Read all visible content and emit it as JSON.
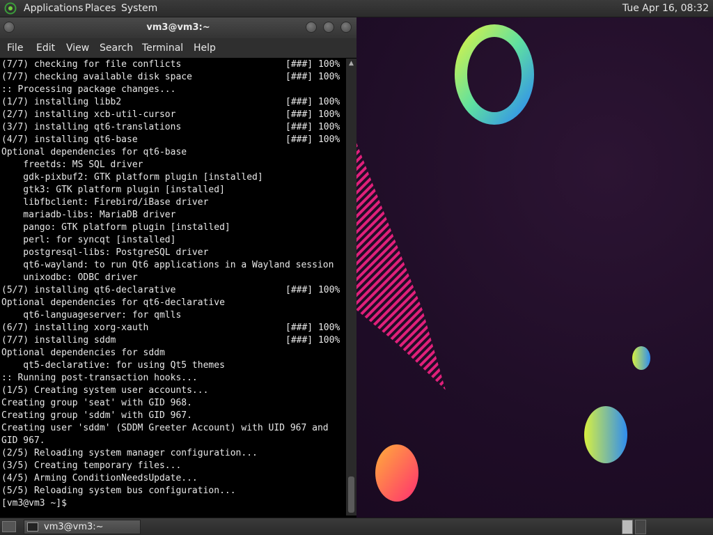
{
  "top_panel": {
    "menus": [
      "Applications",
      "Places",
      "System"
    ],
    "clock": "Tue Apr 16, 08:32"
  },
  "terminal": {
    "title": "vm3@vm3:~",
    "menu": [
      "File",
      "Edit",
      "View",
      "Search",
      "Terminal",
      "Help"
    ],
    "lines": [
      {
        "text": "(7/7) checking for file conflicts",
        "status": "[###] 100%"
      },
      {
        "text": "(7/7) checking available disk space",
        "status": "[###] 100%"
      },
      {
        "text": ":: Processing package changes...",
        "status": ""
      },
      {
        "text": "(1/7) installing libb2",
        "status": "[###] 100%"
      },
      {
        "text": "(2/7) installing xcb-util-cursor",
        "status": "[###] 100%"
      },
      {
        "text": "(3/7) installing qt6-translations",
        "status": "[###] 100%"
      },
      {
        "text": "(4/7) installing qt6-base",
        "status": "[###] 100%"
      },
      {
        "text": "Optional dependencies for qt6-base",
        "status": ""
      },
      {
        "text": "    freetds: MS SQL driver",
        "status": ""
      },
      {
        "text": "    gdk-pixbuf2: GTK platform plugin [installed]",
        "status": ""
      },
      {
        "text": "    gtk3: GTK platform plugin [installed]",
        "status": ""
      },
      {
        "text": "    libfbclient: Firebird/iBase driver",
        "status": ""
      },
      {
        "text": "    mariadb-libs: MariaDB driver",
        "status": ""
      },
      {
        "text": "    pango: GTK platform plugin [installed]",
        "status": ""
      },
      {
        "text": "    perl: for syncqt [installed]",
        "status": ""
      },
      {
        "text": "    postgresql-libs: PostgreSQL driver",
        "status": ""
      },
      {
        "text": "    qt6-wayland: to run Qt6 applications in a Wayland session",
        "status": ""
      },
      {
        "text": "    unixodbc: ODBC driver",
        "status": ""
      },
      {
        "text": "(5/7) installing qt6-declarative",
        "status": "[###] 100%"
      },
      {
        "text": "Optional dependencies for qt6-declarative",
        "status": ""
      },
      {
        "text": "    qt6-languageserver: for qmlls",
        "status": ""
      },
      {
        "text": "(6/7) installing xorg-xauth",
        "status": "[###] 100%"
      },
      {
        "text": "(7/7) installing sddm",
        "status": "[###] 100%"
      },
      {
        "text": "Optional dependencies for sddm",
        "status": ""
      },
      {
        "text": "    qt5-declarative: for using Qt5 themes",
        "status": ""
      },
      {
        "text": ":: Running post-transaction hooks...",
        "status": ""
      },
      {
        "text": "(1/5) Creating system user accounts...",
        "status": ""
      },
      {
        "text": "Creating group 'seat' with GID 968.",
        "status": ""
      },
      {
        "text": "Creating group 'sddm' with GID 967.",
        "status": ""
      },
      {
        "text": "Creating user 'sddm' (SDDM Greeter Account) with UID 967 and",
        "status": ""
      },
      {
        "text": "GID 967.",
        "status": ""
      },
      {
        "text": "(2/5) Reloading system manager configuration...",
        "status": ""
      },
      {
        "text": "(3/5) Creating temporary files...",
        "status": ""
      },
      {
        "text": "(4/5) Arming ConditionNeedsUpdate...",
        "status": ""
      },
      {
        "text": "(5/5) Reloading system bus configuration...",
        "status": ""
      },
      {
        "text": "[vm3@vm3 ~]$ ",
        "status": ""
      }
    ]
  },
  "taskbar": {
    "task_label": "vm3@vm3:~"
  }
}
